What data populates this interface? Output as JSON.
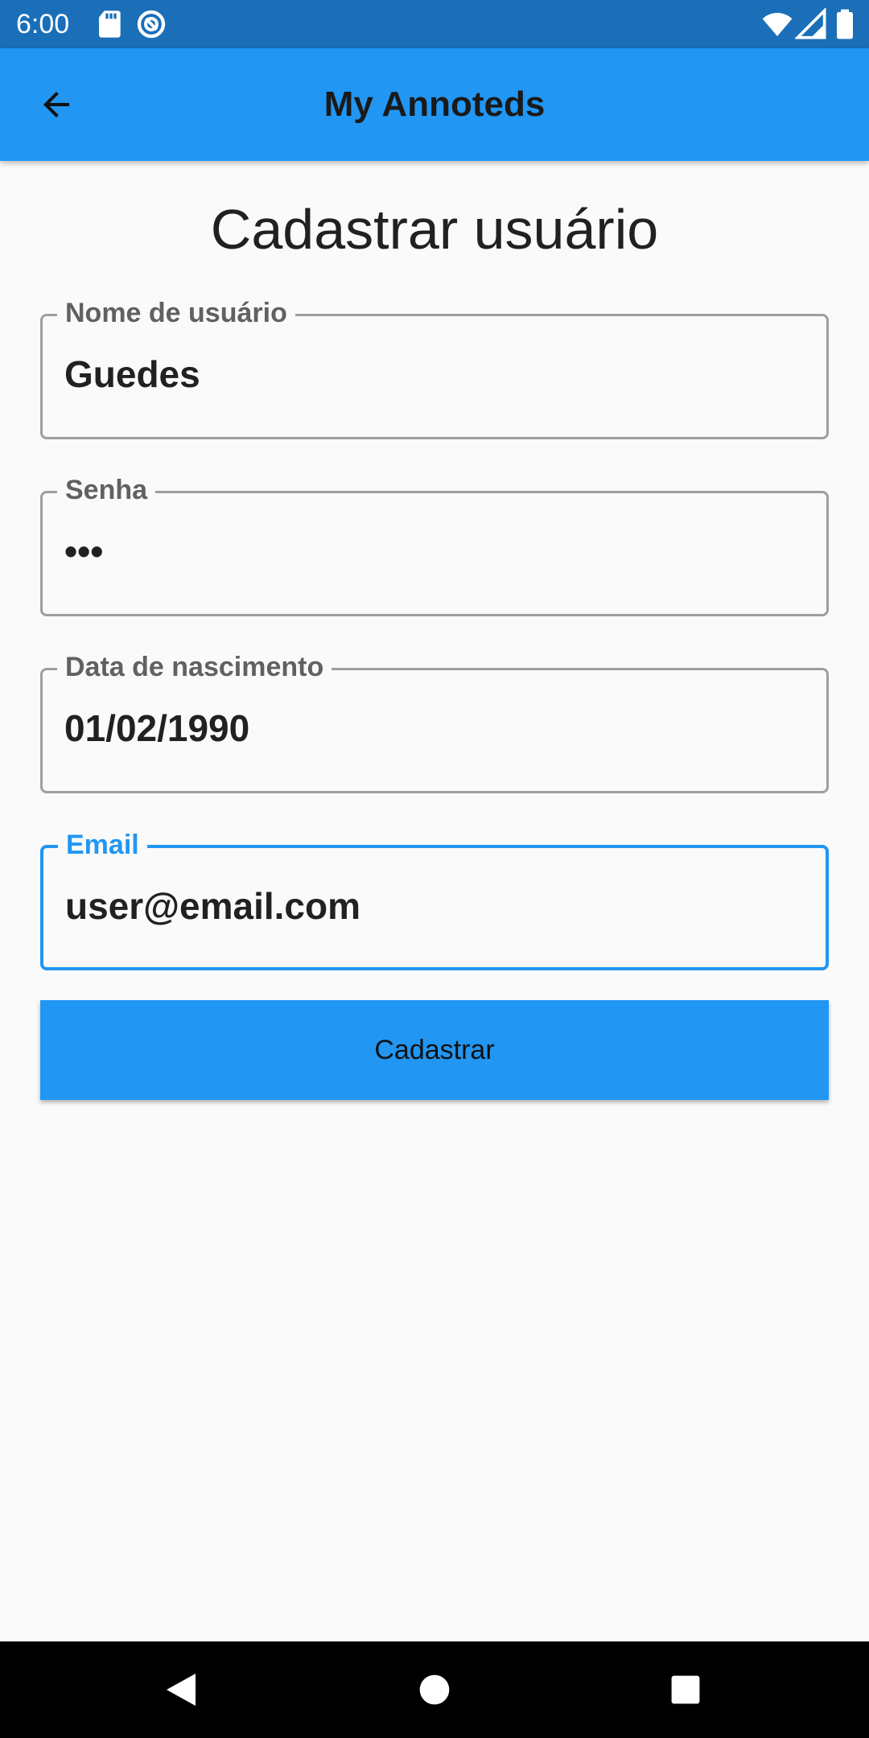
{
  "status_bar": {
    "time": "6:00",
    "icons": [
      "sd-card-icon",
      "sync-icon",
      "wifi-icon",
      "signal-icon",
      "battery-icon"
    ]
  },
  "app_bar": {
    "title": "My Annoteds",
    "back_icon": "arrow-back-icon",
    "color": "#2196f3"
  },
  "form": {
    "title": "Cadastrar usuário",
    "fields": [
      {
        "label": "Nome de usuário",
        "value": "Guedes",
        "type": "text"
      },
      {
        "label": "Senha",
        "value": "•••",
        "type": "password"
      },
      {
        "label": "Data de nascimento",
        "value": "01/02/1990",
        "type": "text"
      },
      {
        "label": "Email",
        "value": "user@email.com",
        "type": "email",
        "focused": true
      }
    ],
    "submit_label": "Cadastrar"
  },
  "nav_bar": {
    "icons": [
      "back-triangle-icon",
      "home-circle-icon",
      "recents-square-icon"
    ]
  },
  "colors": {
    "status_bar": "#1a6fb8",
    "accent": "#2196f3",
    "background": "#fafafa",
    "field_border": "#9e9e9e"
  }
}
